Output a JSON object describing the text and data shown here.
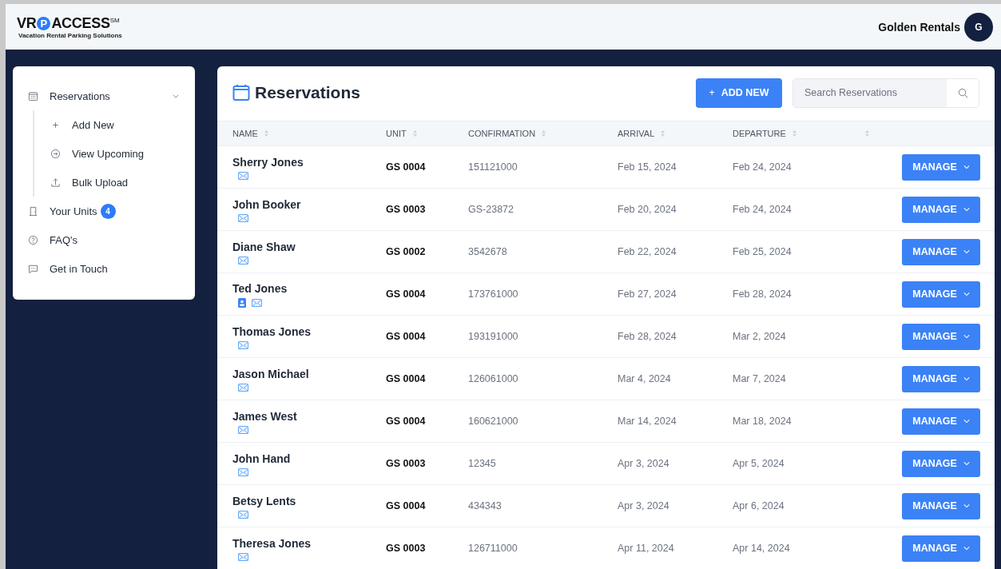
{
  "logo": {
    "left": "VR",
    "badge": "P",
    "right": "ACCESS",
    "mark": "SM",
    "tagline": "Vacation Rental Parking Solutions"
  },
  "user": {
    "name": "Golden Rentals",
    "initial": "G"
  },
  "sidebar": {
    "items": [
      {
        "kind": "calendar",
        "label": "Reservations",
        "expanded": true,
        "children": [
          {
            "kind": "plus",
            "label": "Add New"
          },
          {
            "kind": "arrow",
            "label": "View Upcoming"
          },
          {
            "kind": "upload",
            "label": "Bulk Upload"
          }
        ]
      },
      {
        "kind": "door",
        "label": "Your Units",
        "badge": "4"
      },
      {
        "kind": "help",
        "label": "FAQ's"
      },
      {
        "kind": "chat",
        "label": "Get in Touch"
      }
    ]
  },
  "page": {
    "title": "Reservations",
    "add_button": {
      "icon": "+",
      "label": "ADD NEW"
    },
    "search": {
      "placeholder": "Search Reservations"
    }
  },
  "table": {
    "columns": [
      "NAME",
      "UNIT",
      "CONFIRMATION",
      "ARRIVAL",
      "DEPARTURE"
    ],
    "rows": [
      {
        "name": "Sherry Jones",
        "id_card": false,
        "unit": "GS 0004",
        "confirmation": "151121000",
        "arrival": "Feb 15, 2024",
        "departure": "Feb 24, 2024",
        "action": "MANAGE"
      },
      {
        "name": "John Booker",
        "id_card": false,
        "unit": "GS 0003",
        "confirmation": "GS-23872",
        "arrival": "Feb 20, 2024",
        "departure": "Feb 24, 2024",
        "action": "MANAGE"
      },
      {
        "name": "Diane Shaw",
        "id_card": false,
        "unit": "GS 0002",
        "confirmation": "3542678",
        "arrival": "Feb 22, 2024",
        "departure": "Feb 25, 2024",
        "action": "MANAGE"
      },
      {
        "name": "Ted Jones",
        "id_card": true,
        "unit": "GS 0004",
        "confirmation": "173761000",
        "arrival": "Feb 27, 2024",
        "departure": "Feb 28, 2024",
        "action": "MANAGE"
      },
      {
        "name": "Thomas Jones",
        "id_card": false,
        "unit": "GS 0004",
        "confirmation": "193191000",
        "arrival": "Feb 28, 2024",
        "departure": "Mar 2, 2024",
        "action": "MANAGE"
      },
      {
        "name": "Jason Michael",
        "id_card": false,
        "unit": "GS 0004",
        "confirmation": "126061000",
        "arrival": "Mar 4, 2024",
        "departure": "Mar 7, 2024",
        "action": "MANAGE"
      },
      {
        "name": "James West",
        "id_card": false,
        "unit": "GS 0004",
        "confirmation": "160621000",
        "arrival": "Mar 14, 2024",
        "departure": "Mar 18, 2024",
        "action": "MANAGE"
      },
      {
        "name": "John Hand",
        "id_card": false,
        "unit": "GS 0003",
        "confirmation": "12345",
        "arrival": "Apr 3, 2024",
        "departure": "Apr 5, 2024",
        "action": "MANAGE"
      },
      {
        "name": "Betsy Lents",
        "id_card": false,
        "unit": "GS 0004",
        "confirmation": "434343",
        "arrival": "Apr 3, 2024",
        "departure": "Apr 6, 2024",
        "action": "MANAGE"
      },
      {
        "name": "Theresa Jones",
        "id_card": false,
        "unit": "GS 0003",
        "confirmation": "126711000",
        "arrival": "Apr 11, 2024",
        "departure": "Apr 14, 2024",
        "action": "MANAGE"
      }
    ]
  }
}
